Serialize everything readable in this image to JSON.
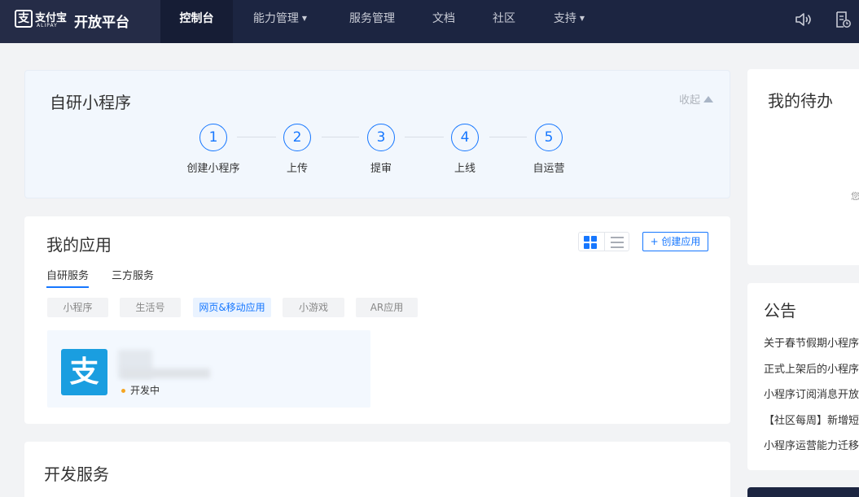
{
  "header": {
    "logo_cn": "支付宝",
    "logo_en": "ALIPAY",
    "platform": "开放平台",
    "nav": [
      {
        "label": "控制台",
        "dropdown": false,
        "active": true
      },
      {
        "label": "能力管理",
        "dropdown": true,
        "active": false
      },
      {
        "label": "服务管理",
        "dropdown": false,
        "active": false
      },
      {
        "label": "文档",
        "dropdown": false,
        "active": false
      },
      {
        "label": "社区",
        "dropdown": false,
        "active": false
      },
      {
        "label": "支持",
        "dropdown": true,
        "active": false
      }
    ],
    "icons": [
      "speaker-icon",
      "document-clock-icon"
    ]
  },
  "self_dev": {
    "title": "自研小程序",
    "collapse_label": "收起",
    "steps": [
      {
        "num": "1",
        "label": "创建小程序"
      },
      {
        "num": "2",
        "label": "上传"
      },
      {
        "num": "3",
        "label": "提审"
      },
      {
        "num": "4",
        "label": "上线"
      },
      {
        "num": "5",
        "label": "自运营"
      }
    ]
  },
  "apps": {
    "title": "我的应用",
    "create_label": "+ 创建应用",
    "view_modes": [
      "grid-view-icon",
      "list-view-icon"
    ],
    "tabs": [
      "自研服务",
      "三方服务"
    ],
    "active_tab": "自研服务",
    "chips": [
      "小程序",
      "生活号",
      "网页&移动应用",
      "小游戏",
      "AR应用"
    ],
    "active_chip": "网页&移动应用",
    "app": {
      "logo_char": "支",
      "status": "开发中"
    }
  },
  "dev_services": {
    "title": "开发服务"
  },
  "todo": {
    "title": "我的待办",
    "hint": "您"
  },
  "notices": {
    "title": "公告",
    "items": [
      "关于春节假期小程序",
      "正式上架后的小程序",
      "小程序订阅消息开放",
      "【社区每周】新增短",
      "小程序运营能力迁移"
    ]
  },
  "colors": {
    "accent": "#1677ff",
    "nav_bg": "#1c2541",
    "status_dot": "#f5a623"
  }
}
